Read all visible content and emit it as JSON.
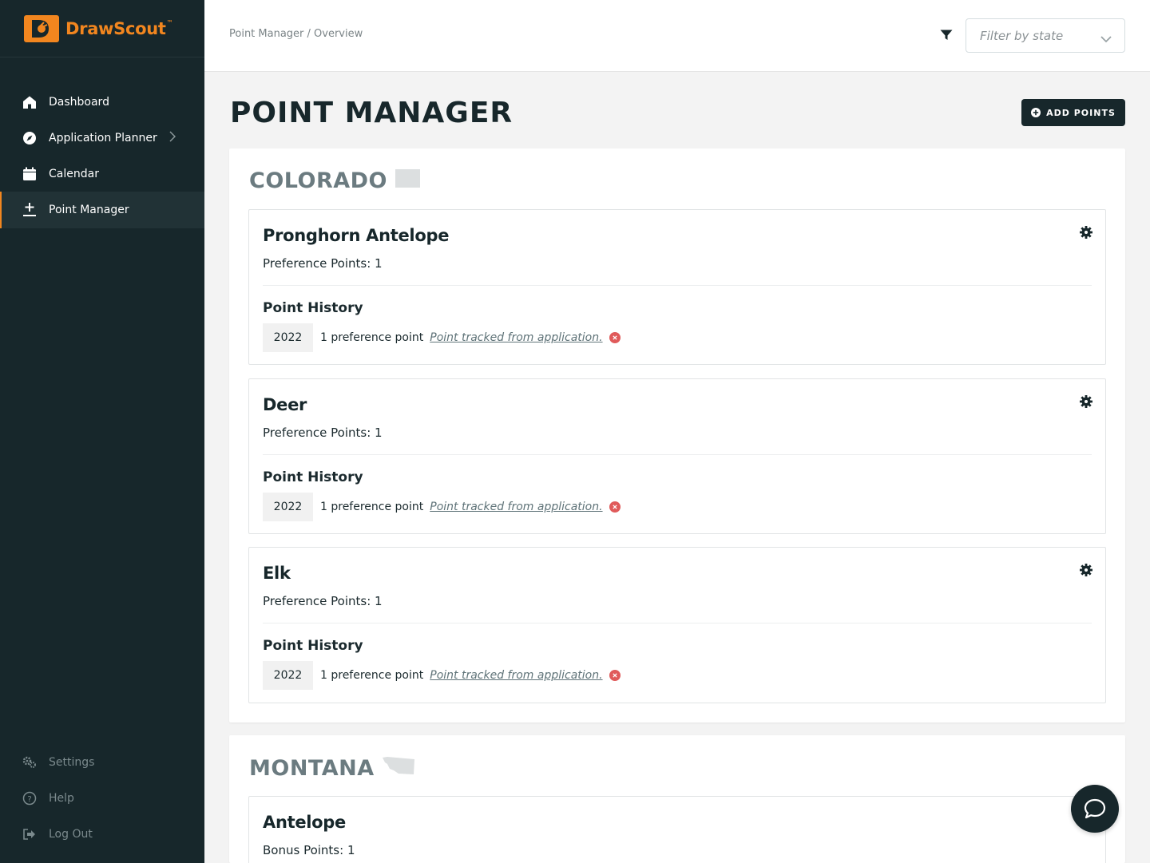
{
  "brand": {
    "name_part1": "Draw",
    "name_part2": "Scout",
    "tm": "™",
    "accent": "#f2861f",
    "sidebar_bg": "#17272b"
  },
  "sidebar": {
    "items": [
      {
        "label": "Dashboard",
        "icon": "home-icon"
      },
      {
        "label": "Application Planner",
        "icon": "compass-icon",
        "has_chevron": true
      },
      {
        "label": "Calendar",
        "icon": "calendar-icon"
      },
      {
        "label": "Point Manager",
        "icon": "plus-minus-icon",
        "active": true
      }
    ],
    "bottom_items": [
      {
        "label": "Settings",
        "icon": "gears-icon"
      },
      {
        "label": "Help",
        "icon": "help-icon"
      },
      {
        "label": "Log Out",
        "icon": "logout-icon"
      }
    ]
  },
  "topbar": {
    "breadcrumb": "Point Manager / Overview",
    "filter_placeholder": "Filter by state"
  },
  "page": {
    "title": "POINT MANAGER",
    "add_button_label": "ADD POINTS"
  },
  "states": [
    {
      "name": "COLORADO",
      "species": [
        {
          "name": "Pronghorn Antelope",
          "points": "Preference Points: 1",
          "history_title": "Point History",
          "history": [
            {
              "year": "2022",
              "text": "1 preference point",
              "link": "Point tracked from application."
            }
          ]
        },
        {
          "name": "Deer",
          "points": "Preference Points: 1",
          "history_title": "Point History",
          "history": [
            {
              "year": "2022",
              "text": "1 preference point",
              "link": "Point tracked from application."
            }
          ]
        },
        {
          "name": "Elk",
          "points": "Preference Points: 1",
          "history_title": "Point History",
          "history": [
            {
              "year": "2022",
              "text": "1 preference point",
              "link": "Point tracked from application."
            }
          ]
        }
      ]
    },
    {
      "name": "MONTANA",
      "species": [
        {
          "name": "Antelope",
          "points": "Bonus Points: 1"
        }
      ]
    }
  ]
}
